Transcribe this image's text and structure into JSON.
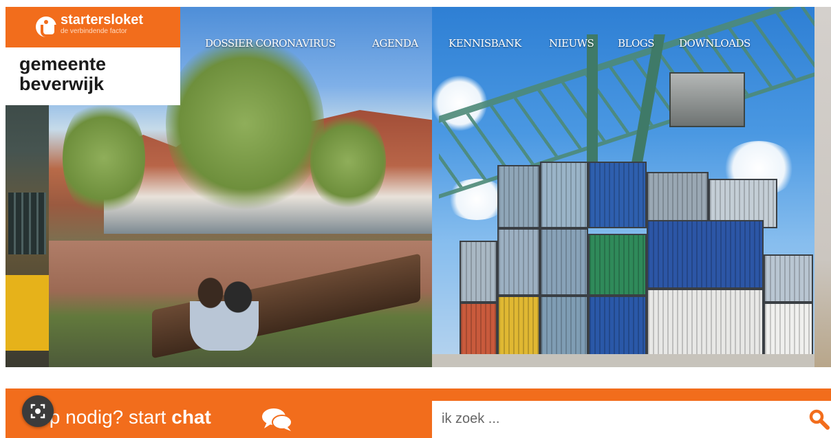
{
  "brand": {
    "name": "startersloket",
    "tagline": "de verbindende factor",
    "municipality_line1": "gemeente",
    "municipality_line2": "beverwijk",
    "accent_color": "#f26d1c"
  },
  "nav": {
    "items": [
      {
        "label": "DOSSIER CORONAVIRUS"
      },
      {
        "label": "AGENDA"
      },
      {
        "label": "KENNISBANK"
      },
      {
        "label": "NIEUWS"
      },
      {
        "label": "BLOGS"
      },
      {
        "label": "DOWNLOADS"
      }
    ]
  },
  "hero": {
    "left_image": "town street with trees, benches and people",
    "right_image": "stacked shipping containers under a harbour crane"
  },
  "help": {
    "prefix": "ulp nodig? start ",
    "chat_word": "chat",
    "icon": "chat-bubbles-icon"
  },
  "search": {
    "placeholder": "ik zoek ...",
    "icon": "search-icon"
  },
  "overlay": {
    "icon": "lens-icon"
  }
}
